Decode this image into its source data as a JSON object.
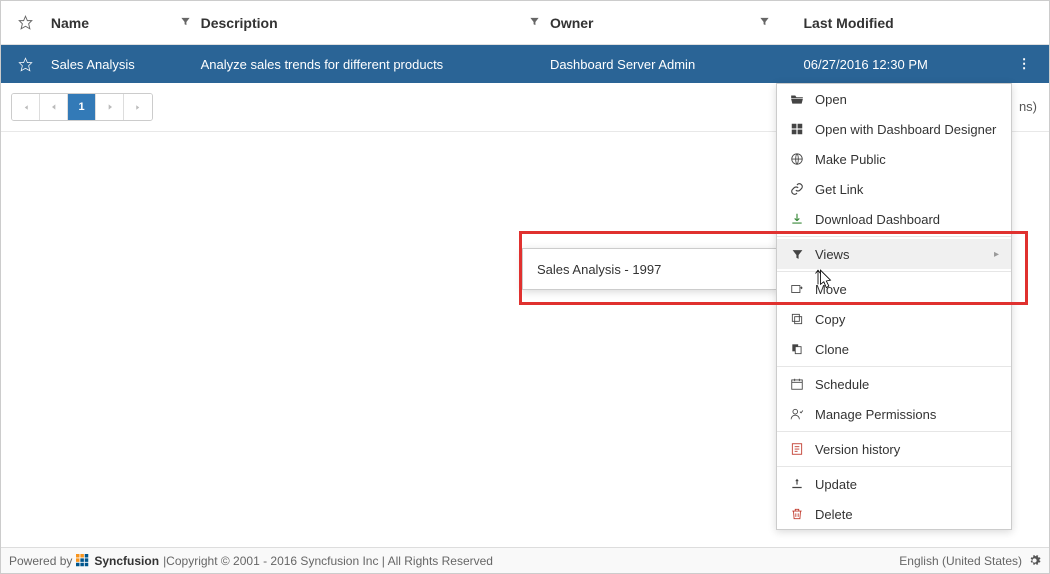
{
  "columns": {
    "name": "Name",
    "description": "Description",
    "owner": "Owner",
    "last_modified": "Last Modified"
  },
  "row": {
    "name": "Sales Analysis",
    "description": "Analyze sales trends for different products",
    "owner": "Dashboard Server Admin",
    "last_modified": "06/27/2016 12:30 PM"
  },
  "pager": {
    "current": "1",
    "summary_suffix": "ns)"
  },
  "menu": {
    "open": "Open",
    "open_with": "Open with Dashboard Designer",
    "make_public": "Make Public",
    "get_link": "Get Link",
    "download": "Download Dashboard",
    "views": "Views",
    "move": "Move",
    "copy": "Copy",
    "clone": "Clone",
    "schedule": "Schedule",
    "permissions": "Manage Permissions",
    "version": "Version history",
    "update": "Update",
    "delete": "Delete"
  },
  "submenu": {
    "item": "Sales Analysis - 1997"
  },
  "footer": {
    "powered_by": "Powered by",
    "brand": "Syncfusion",
    "copyright": "|Copyright © 2001 - 2016 Syncfusion Inc | All Rights Reserved",
    "language": "English (United States)"
  }
}
